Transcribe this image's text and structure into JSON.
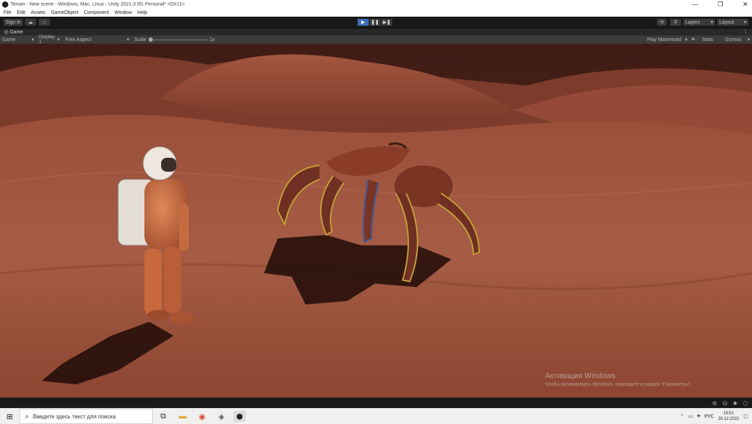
{
  "window": {
    "title": "Terrain - New scene - Windows, Mac, Linux - Unity 2021.3.5f1 Personal* <DX11>",
    "minimize_glyph": "—",
    "restore_glyph": "❐",
    "close_glyph": "✕"
  },
  "menu": [
    "File",
    "Edit",
    "Assets",
    "GameObject",
    "Component",
    "Window",
    "Help"
  ],
  "toolbar": {
    "sign_in_label": "Sign in",
    "layers_label": "Layers",
    "layout_label": "Layout",
    "play_mode": "playing"
  },
  "game_view": {
    "tab_label": "Game",
    "game_dropdown": "Game",
    "display_dropdown": "Display 1",
    "aspect_dropdown": "Free Aspect",
    "scale_label": "Scale",
    "scale_value": "1x",
    "play_maximized_label": "Play Maximized",
    "stats_label": "Stats",
    "gizmos_label": "Gizmos"
  },
  "watermark": {
    "title": "Активация Windows",
    "subtitle": "Чтобы активировать Windows, перейдите в раздел \"Параметры\"."
  },
  "taskbar": {
    "search_placeholder": "Введите здесь текст для поиска",
    "language": "РУС",
    "time": "19:51",
    "date": "30.12.2022"
  },
  "colors": {
    "play_active": "#3d6fb5",
    "sand_dark": "#5a2a1f",
    "sand_light": "#a65c45"
  }
}
